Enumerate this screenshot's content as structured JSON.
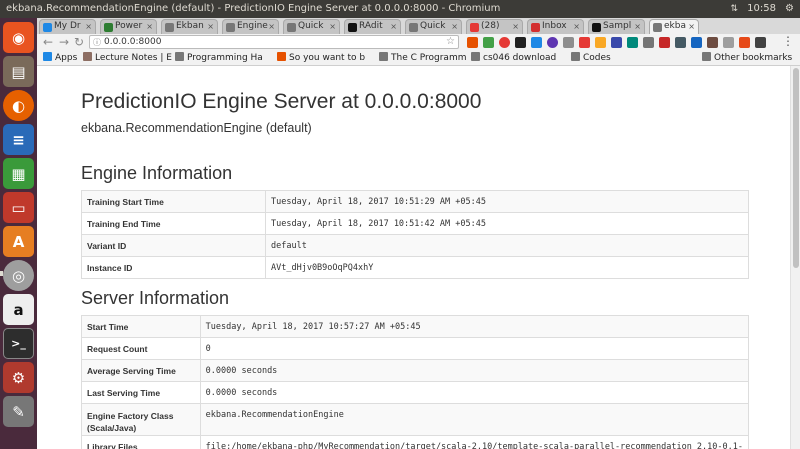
{
  "system_bar": {
    "window_title": "ekbana.RecommendationEngine (default) - PredictionIO Engine Server at 0.0.0.0:8000 - Chromium",
    "clock": "10:58",
    "net_indicator": "⇅"
  },
  "launcher": {
    "items": [
      "ubuntu-dash",
      "files",
      "firefox",
      "writer",
      "calc",
      "impress",
      "software-center",
      "chromium",
      "amazon",
      "terminal",
      "system-settings",
      "editor"
    ]
  },
  "tabs": [
    {
      "label": "My Dr",
      "color": "#1e88e5"
    },
    {
      "label": "Power",
      "color": "#2e7d32"
    },
    {
      "label": "Ekban",
      "color": "#777777"
    },
    {
      "label": "Engine",
      "color": "#777777"
    },
    {
      "label": "Quick",
      "color": "#777777"
    },
    {
      "label": "RAdit",
      "color": "#111111"
    },
    {
      "label": "Quick",
      "color": "#777777"
    },
    {
      "label": "(28)",
      "color": "#e53935"
    },
    {
      "label": "Inbox",
      "color": "#d32f2f"
    },
    {
      "label": "Sampl",
      "color": "#111111"
    },
    {
      "label": "ekba",
      "color": "#777777",
      "active": true
    }
  ],
  "omnibox": {
    "url": "0.0.0.0:8000"
  },
  "bookmarks": {
    "apps_label": "Apps",
    "items": [
      {
        "label": "Lecture Notes | E",
        "color": "#8d6e63"
      },
      {
        "label": "Programming Ha",
        "color": "#777777"
      },
      {
        "label": "So you want to b",
        "color": "#e65100"
      },
      {
        "label": "The C Programm",
        "color": "#777777"
      },
      {
        "label": "cs046 download",
        "color": "#777777"
      },
      {
        "label": "Codes",
        "color": "#777777"
      }
    ],
    "other_label": "Other bookmarks"
  },
  "page": {
    "title": "PredictionIO Engine Server at 0.0.0.0:8000",
    "subtitle": "ekbana.RecommendationEngine (default)",
    "engine_heading": "Engine Information",
    "engine_rows": [
      {
        "label": "Training Start Time",
        "value": "Tuesday, April 18, 2017 10:51:29 AM +05:45"
      },
      {
        "label": "Training End Time",
        "value": "Tuesday, April 18, 2017 10:51:42 AM +05:45"
      },
      {
        "label": "Variant ID",
        "value": "default"
      },
      {
        "label": "Instance ID",
        "value": "AVt_dHjv0B9oOqPQ4xhY"
      }
    ],
    "server_heading": "Server Information",
    "server_rows": [
      {
        "label": "Start Time",
        "value": "Tuesday, April 18, 2017 10:57:27 AM +05:45"
      },
      {
        "label": "Request Count",
        "value": "0"
      },
      {
        "label": "Average Serving Time",
        "value": "0.0000 seconds"
      },
      {
        "label": "Last Serving Time",
        "value": "0.0000 seconds"
      },
      {
        "label": "Engine Factory Class (Scala/Java)",
        "value": "ekbana.RecommendationEngine"
      },
      {
        "label": "Library Files",
        "value": "file:/home/ekbana-php/MyRecommendation/target/scala-2.10/template-scala-parallel-recommendation_2.10-0.1-"
      }
    ]
  }
}
